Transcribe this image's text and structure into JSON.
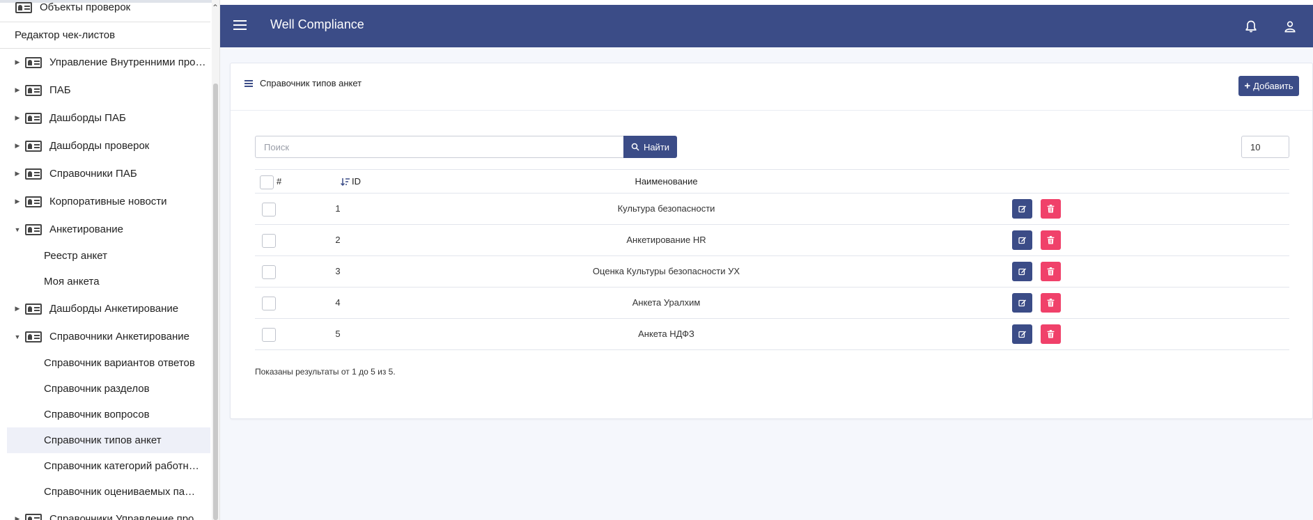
{
  "header": {
    "app_title": "Well Compliance"
  },
  "sidebar": {
    "top_item": "Объекты проверок",
    "checklist_editor": "Редактор чек-листов",
    "items": [
      {
        "label": "Управление Внутренними проверками",
        "expanded": false
      },
      {
        "label": "ПАБ",
        "expanded": false
      },
      {
        "label": "Дашборды ПАБ",
        "expanded": false
      },
      {
        "label": "Дашборды проверок",
        "expanded": false
      },
      {
        "label": "Справочники ПАБ",
        "expanded": false
      },
      {
        "label": "Корпоративные новости",
        "expanded": false
      },
      {
        "label": "Анкетирование",
        "expanded": true
      },
      {
        "label": "Дашборды Анкетирование",
        "expanded": false
      },
      {
        "label": "Справочники Анкетирование",
        "expanded": true
      },
      {
        "label": "Справочники Управление проверками",
        "expanded": false
      }
    ],
    "survey_children": [
      "Реестр анкет",
      "Моя анкета"
    ],
    "survey_dict_children": [
      "Справочник вариантов ответов",
      "Справочник разделов",
      "Справочник вопросов",
      "Справочник типов анкет",
      "Справочник категорий работников",
      "Справочник оцениваемых параметров"
    ],
    "active_item": "Справочник типов анкет"
  },
  "panel": {
    "title": "Справочник типов анкет",
    "add_label": "Добавить"
  },
  "search": {
    "placeholder": "Поиск",
    "value": "",
    "button_label": "Найти"
  },
  "page_size": "10",
  "table": {
    "headers": {
      "hash": "#",
      "id": "ID",
      "name": "Наименование"
    },
    "rows": [
      {
        "id": "1",
        "name": "Культура безопасности"
      },
      {
        "id": "2",
        "name": "Анкетирование HR"
      },
      {
        "id": "3",
        "name": "Оценка Культуры безопасности УХ"
      },
      {
        "id": "4",
        "name": "Анкета Уралхим"
      },
      {
        "id": "5",
        "name": "Анкета НДФЗ"
      }
    ]
  },
  "result_text": "Показаны результаты от 1 до 5 из 5.",
  "colors": {
    "primary": "#3b4c87",
    "danger": "#f0416a",
    "background": "#f5f7fc",
    "active_item_bg": "#eef0f8"
  }
}
